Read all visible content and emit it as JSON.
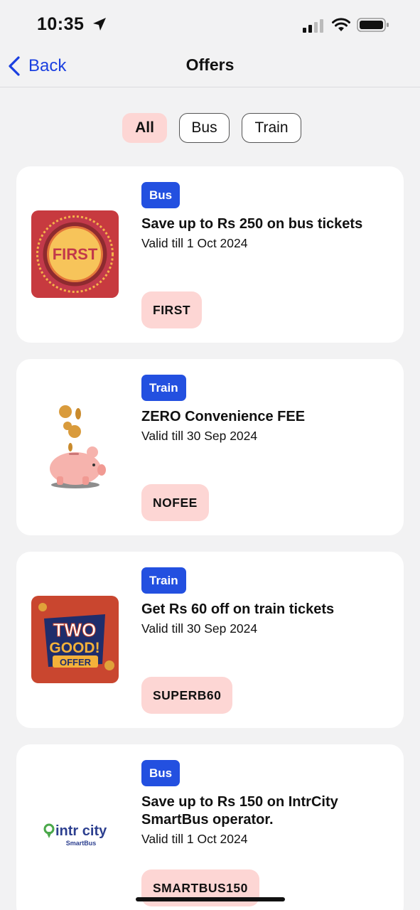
{
  "status_bar": {
    "time": "10:35"
  },
  "nav": {
    "back_label": "Back",
    "title": "Offers"
  },
  "filters": [
    {
      "label": "All",
      "active": true
    },
    {
      "label": "Bus",
      "active": false
    },
    {
      "label": "Train",
      "active": false
    }
  ],
  "offers": [
    {
      "tag": "Bus",
      "title": "Save up to Rs 250 on bus tickets",
      "valid": "Valid till 1 Oct 2024",
      "code": "FIRST",
      "image_text": "FIRST"
    },
    {
      "tag": "Train",
      "title": "ZERO Convenience FEE",
      "valid": "Valid till 30 Sep 2024",
      "code": "NOFEE"
    },
    {
      "tag": "Train",
      "title": "Get Rs 60 off on train tickets",
      "valid": "Valid till 30 Sep 2024",
      "code": "SUPERB60",
      "image_text": {
        "line1": "TWO",
        "line2": "GOOD!",
        "line3": "OFFER"
      }
    },
    {
      "tag": "Bus",
      "title": "Save up to Rs 150 on IntrCity SmartBus operator.",
      "valid": "Valid till 1 Oct 2024",
      "code": "SMARTBUS150",
      "image_text": {
        "brand": "intr city",
        "sub": "SmartBus"
      }
    }
  ],
  "colors": {
    "accent_blue": "#1a3fe0",
    "tag_blue": "#2350e0",
    "chip_pink": "#fdd6d4"
  }
}
